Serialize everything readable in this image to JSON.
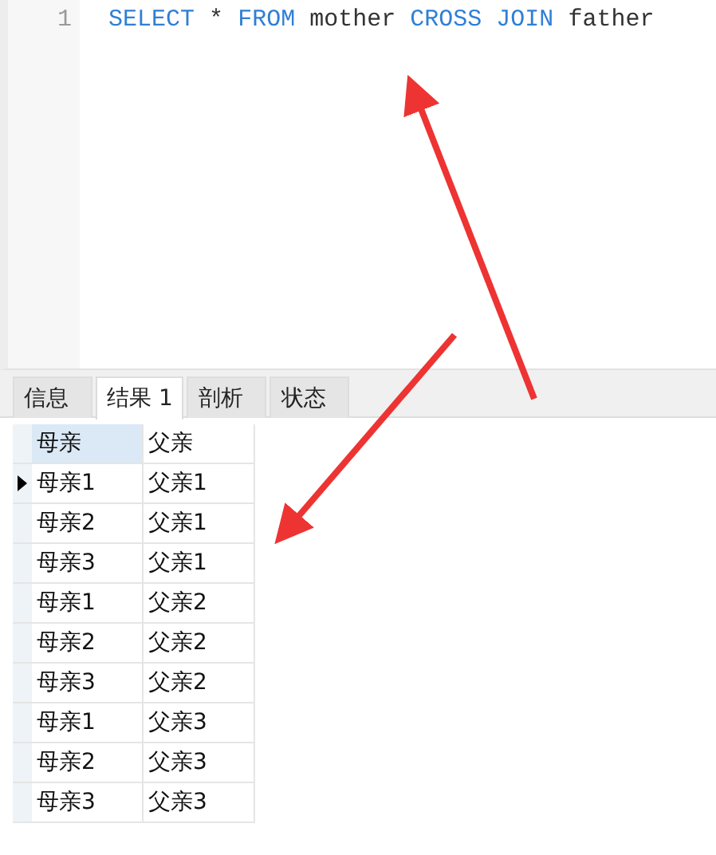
{
  "editor": {
    "lines": [
      {
        "number": "1",
        "tokens": [
          {
            "text": "SELECT",
            "kind": "keyword"
          },
          {
            "text": "*",
            "kind": "plain"
          },
          {
            "text": "FROM",
            "kind": "keyword"
          },
          {
            "text": "mother",
            "kind": "plain"
          },
          {
            "text": "CROSS",
            "kind": "keyword"
          },
          {
            "text": "JOIN",
            "kind": "keyword"
          },
          {
            "text": "father",
            "kind": "plain"
          }
        ]
      }
    ]
  },
  "tabs": [
    {
      "label": "信息",
      "selected": false
    },
    {
      "label": "结果 1",
      "selected": true
    },
    {
      "label": "剖析",
      "selected": false
    },
    {
      "label": "状态",
      "selected": false
    }
  ],
  "grid": {
    "columns": [
      "母亲",
      "父亲"
    ],
    "rows": [
      {
        "cells": [
          "母亲1",
          "父亲1"
        ],
        "selected": true
      },
      {
        "cells": [
          "母亲2",
          "父亲1"
        ],
        "selected": false
      },
      {
        "cells": [
          "母亲3",
          "父亲1"
        ],
        "selected": false
      },
      {
        "cells": [
          "母亲1",
          "父亲2"
        ],
        "selected": false
      },
      {
        "cells": [
          "母亲2",
          "父亲2"
        ],
        "selected": false
      },
      {
        "cells": [
          "母亲3",
          "父亲2"
        ],
        "selected": false
      },
      {
        "cells": [
          "母亲1",
          "父亲3"
        ],
        "selected": false
      },
      {
        "cells": [
          "母亲2",
          "父亲3"
        ],
        "selected": false
      },
      {
        "cells": [
          "母亲3",
          "父亲3"
        ],
        "selected": false
      }
    ]
  }
}
